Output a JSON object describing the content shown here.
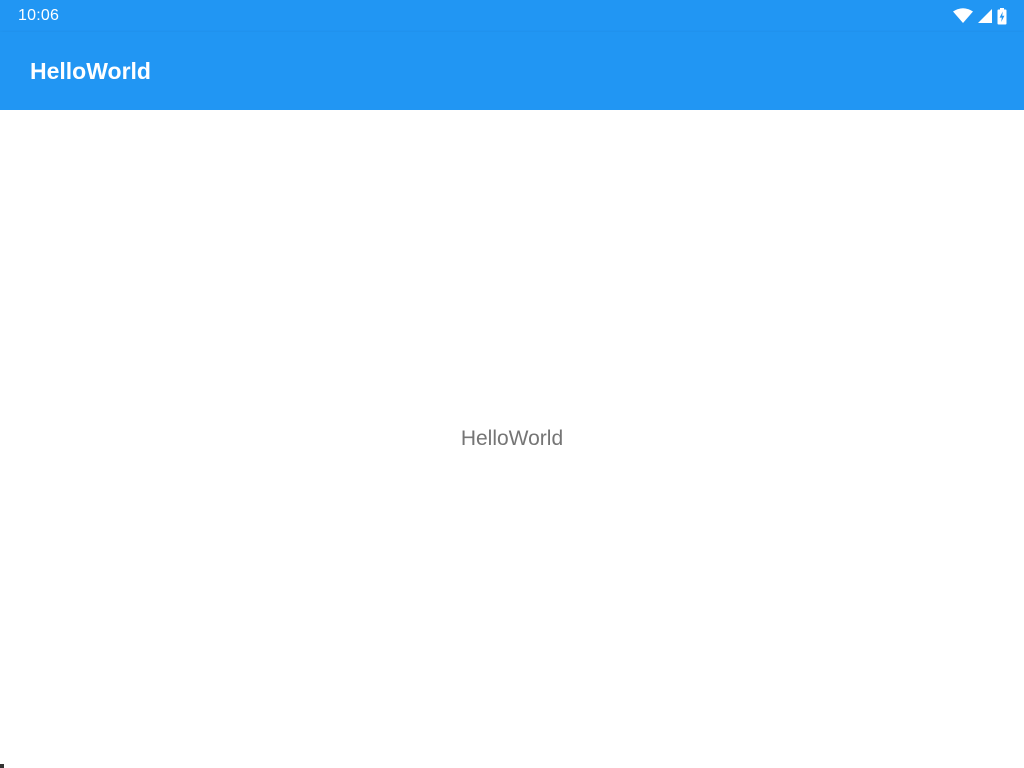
{
  "status_bar": {
    "time": "10:06",
    "icons": [
      "wifi-icon",
      "cellular-signal-icon",
      "battery-charging-icon"
    ]
  },
  "app_bar": {
    "title": "HelloWorld"
  },
  "main": {
    "label": "HelloWorld"
  },
  "colors": {
    "primary": "#2196f3",
    "on_primary": "#ffffff",
    "body_text": "#757575",
    "background": "#ffffff"
  }
}
